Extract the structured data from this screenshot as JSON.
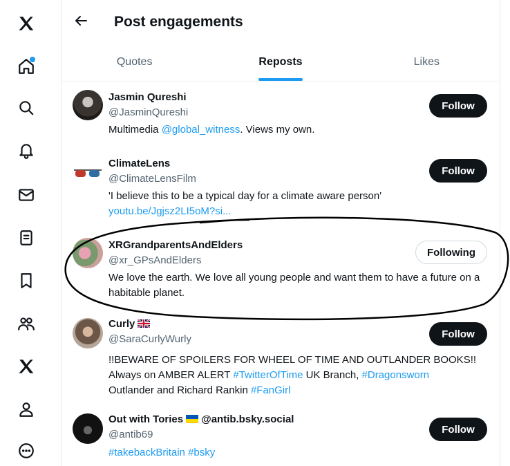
{
  "header": {
    "title": "Post engagements"
  },
  "tabs": [
    {
      "label": "Quotes"
    },
    {
      "label": "Reposts"
    },
    {
      "label": "Likes"
    }
  ],
  "users": [
    {
      "name": "Jasmin Qureshi",
      "handle": "@JasminQureshi",
      "bio_parts": [
        "Multimedia ",
        "@global_witness",
        ". Views my own."
      ],
      "button": "Follow"
    },
    {
      "name": "ClimateLens",
      "handle": "@ClimateLensFilm",
      "bio_line1": "'I believe this to be a typical day for a climate aware person'",
      "bio_link": "youtu.be/Jgjsz2LI5oM?si...",
      "button": "Follow"
    },
    {
      "name": "XRGrandparentsAndElders",
      "handle": "@xr_GPsAndElders",
      "bio": "We love the earth. We love all young people and want them to have a future on a habitable planet.",
      "button": "Following"
    },
    {
      "name": "Curly",
      "handle": "@SaraCurlyWurly",
      "bio_line1": "!!BEWARE OF SPOILERS FOR WHEEL OF TIME AND OUTLANDER BOOKS!!",
      "bio_line2_parts": [
        "Always on AMBER ALERT ",
        "#TwitterOfTime",
        " UK Branch, ",
        "#Dragonsworn"
      ],
      "bio_line3_parts": [
        "Outlander and Richard Rankin ",
        "#FanGirl"
      ],
      "button": "Follow"
    },
    {
      "name_a": "Out with Tories",
      "name_b": "@antib.bsky.social",
      "handle": "@antib69",
      "bio": "#takebackBritain #bsky",
      "button": "Follow"
    }
  ],
  "colors": {
    "accent": "#1d9bf0",
    "text": "#0f1419",
    "muted": "#536471"
  },
  "icons": [
    "x-logo-icon",
    "home-icon",
    "search-icon",
    "notifications-icon",
    "messages-icon",
    "lists-icon",
    "bookmarks-icon",
    "communities-icon",
    "premium-x-icon",
    "profile-icon",
    "more-icon"
  ]
}
